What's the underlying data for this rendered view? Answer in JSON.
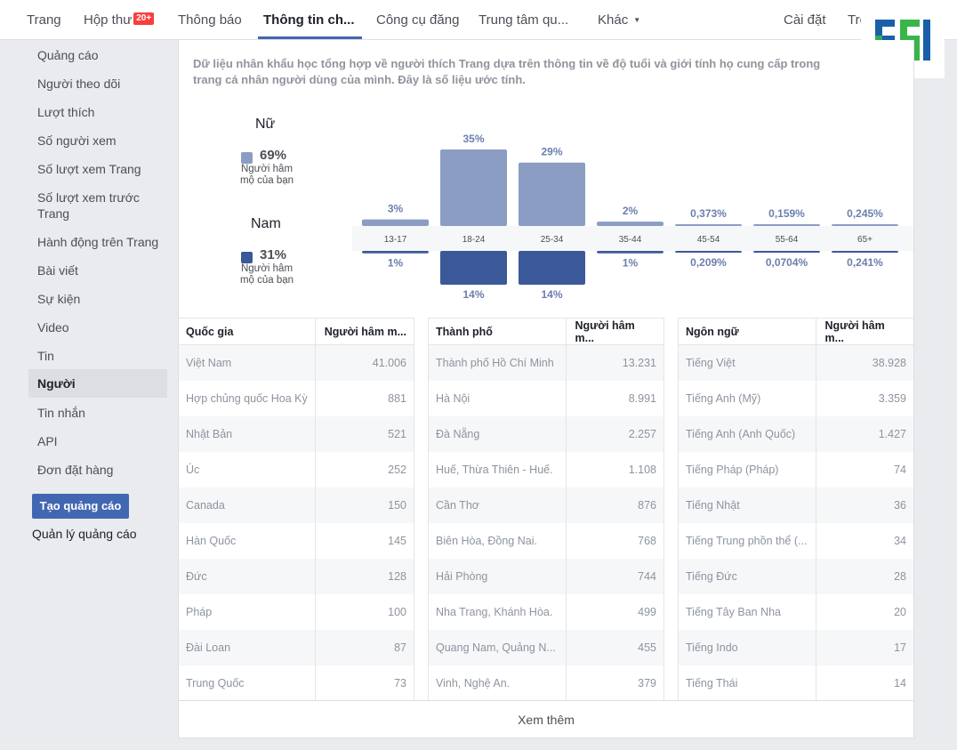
{
  "nav": {
    "items": [
      {
        "label": "Trang"
      },
      {
        "label": "Hộp thư",
        "badge": "20+"
      },
      {
        "label": "Thông báo"
      },
      {
        "label": "Thông tin ch..."
      },
      {
        "label": "Công cụ đăng"
      },
      {
        "label": "Trung tâm qu..."
      },
      {
        "label": "Khác"
      },
      {
        "label": "Cài đặt"
      },
      {
        "label": "Trợ"
      }
    ]
  },
  "sidebar": {
    "items": [
      {
        "label": "Quảng cáo"
      },
      {
        "label": "Người theo dõi"
      },
      {
        "label": "Lượt thích"
      },
      {
        "label": "Số người xem"
      },
      {
        "label": "Số lượt xem Trang"
      },
      {
        "label": "Số lượt xem trước Trang"
      },
      {
        "label": "Hành động trên Trang"
      },
      {
        "label": "Bài viết"
      },
      {
        "label": "Sự kiện"
      },
      {
        "label": "Video"
      },
      {
        "label": "Tin"
      },
      {
        "label": "Người"
      },
      {
        "label": "Tin nhắn"
      },
      {
        "label": "API"
      },
      {
        "label": "Đơn đặt hàng"
      }
    ],
    "active": "Người",
    "create_ad": "Tạo quảng cáo",
    "manage_ads": "Quản lý quảng cáo"
  },
  "description": "Dữ liệu nhân khẩu học tổng hợp về người thích Trang dựa trên thông tin về độ tuổi và giới tính họ cung cấp trong trang cá nhân người dùng của mình. Đây là số liệu ước tính.",
  "description_line1": "Dữ liệu nhân khẩu học tổng hợp về người thích Trang dựa trên thông tin về độ tuổi và giới tính họ cung cấp trong",
  "description_line2": "trang cá nhân người dùng của mình. Đây là số liệu ước tính.",
  "gender": {
    "female": {
      "title": "Nữ",
      "pct": "69%",
      "sub": "Người hâm mộ của bạn",
      "color": "#8b9dc3"
    },
    "male": {
      "title": "Nam",
      "pct": "31%",
      "sub": "Người hâm mộ của bạn",
      "color": "#3b5998"
    }
  },
  "chart_data": {
    "type": "bar",
    "categories": [
      "13-17",
      "18-24",
      "25-34",
      "35-44",
      "45-54",
      "55-64",
      "65+"
    ],
    "series": [
      {
        "name": "Nữ",
        "values": [
          3,
          35,
          29,
          2,
          0.373,
          0.159,
          0.245
        ],
        "labels": [
          "3%",
          "35%",
          "29%",
          "2%",
          "0,373%",
          "0,159%",
          "0,245%"
        ],
        "color": "#8b9dc3"
      },
      {
        "name": "Nam",
        "values": [
          1,
          14,
          14,
          1,
          0.209,
          0.0704,
          0.241
        ],
        "labels": [
          "1%",
          "14%",
          "14%",
          "1%",
          "0,209%",
          "0,0704%",
          "0,241%"
        ],
        "color": "#3b5998"
      }
    ],
    "ylim": [
      0,
      35
    ]
  },
  "tables": [
    {
      "headers": [
        "Quốc gia",
        "Người hâm m..."
      ],
      "rows": [
        [
          "Việt Nam",
          "41.006"
        ],
        [
          "Hợp chủng quốc Hoa Kỳ",
          "881"
        ],
        [
          "Nhật Bản",
          "521"
        ],
        [
          "Úc",
          "252"
        ],
        [
          "Canada",
          "150"
        ],
        [
          "Hàn Quốc",
          "145"
        ],
        [
          "Đức",
          "128"
        ],
        [
          "Pháp",
          "100"
        ],
        [
          "Đài Loan",
          "87"
        ],
        [
          "Trung Quốc",
          "73"
        ]
      ]
    },
    {
      "headers": [
        "Thành phố",
        "Người hâm m..."
      ],
      "rows": [
        [
          "Thành phố Hồ Chí Minh",
          "13.231"
        ],
        [
          "Hà Nội",
          "8.991"
        ],
        [
          "Đà Nẵng",
          "2.257"
        ],
        [
          "Huế, Thừa Thiên - Huế.",
          "1.108"
        ],
        [
          "Cần Thơ",
          "876"
        ],
        [
          "Biên Hòa, Đồng Nai.",
          "768"
        ],
        [
          "Hải Phòng",
          "744"
        ],
        [
          "Nha Trang, Khánh Hòa.",
          "499"
        ],
        [
          "Quang Nam, Quảng N...",
          "455"
        ],
        [
          "Vinh, Nghệ An.",
          "379"
        ]
      ]
    },
    {
      "headers": [
        "Ngôn ngữ",
        "Người hâm m..."
      ],
      "rows": [
        [
          "Tiếng Việt",
          "38.928"
        ],
        [
          "Tiếng Anh (Mỹ)",
          "3.359"
        ],
        [
          "Tiếng Anh (Anh Quốc)",
          "1.427"
        ],
        [
          "Tiếng Pháp (Pháp)",
          "74"
        ],
        [
          "Tiếng Nhật",
          "36"
        ],
        [
          "Tiếng Trung phồn thể (...",
          "34"
        ],
        [
          "Tiếng Đức",
          "28"
        ],
        [
          "Tiếng Tây Ban Nha",
          "20"
        ],
        [
          "Tiếng Indo",
          "17"
        ],
        [
          "Tiếng Thái",
          "14"
        ]
      ]
    }
  ],
  "see_more": "Xem thêm",
  "colors": {
    "accent": "#4267b2",
    "female": "#8b9dc3",
    "male": "#3b5998",
    "logo_blue": "#1a5fa8",
    "logo_green": "#39b54a"
  }
}
